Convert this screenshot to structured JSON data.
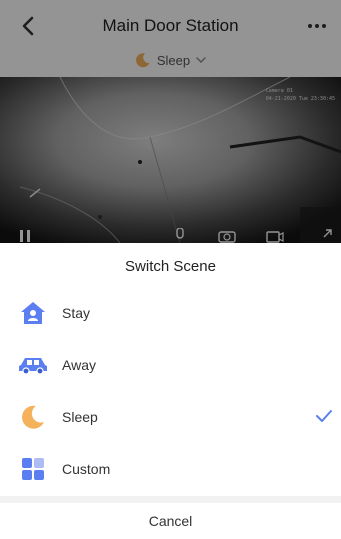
{
  "header": {
    "title": "Main Door Station",
    "scene_label": "Sleep"
  },
  "video": {
    "osd_line1": "Camera 01",
    "osd_line2": "04-21-2020 Tue 23:30:45"
  },
  "sheet": {
    "title": "Switch Scene",
    "items": [
      {
        "label": "Stay",
        "icon": "home-person-icon",
        "selected": false
      },
      {
        "label": "Away",
        "icon": "car-icon",
        "selected": false
      },
      {
        "label": "Sleep",
        "icon": "moon-icon",
        "selected": true
      },
      {
        "label": "Custom",
        "icon": "custom-blocks-icon",
        "selected": false
      }
    ],
    "cancel_label": "Cancel"
  },
  "colors": {
    "accent_blue": "#5b7ef0",
    "moon_orange": "#f5b25c",
    "divider": "#f2f2f2"
  }
}
